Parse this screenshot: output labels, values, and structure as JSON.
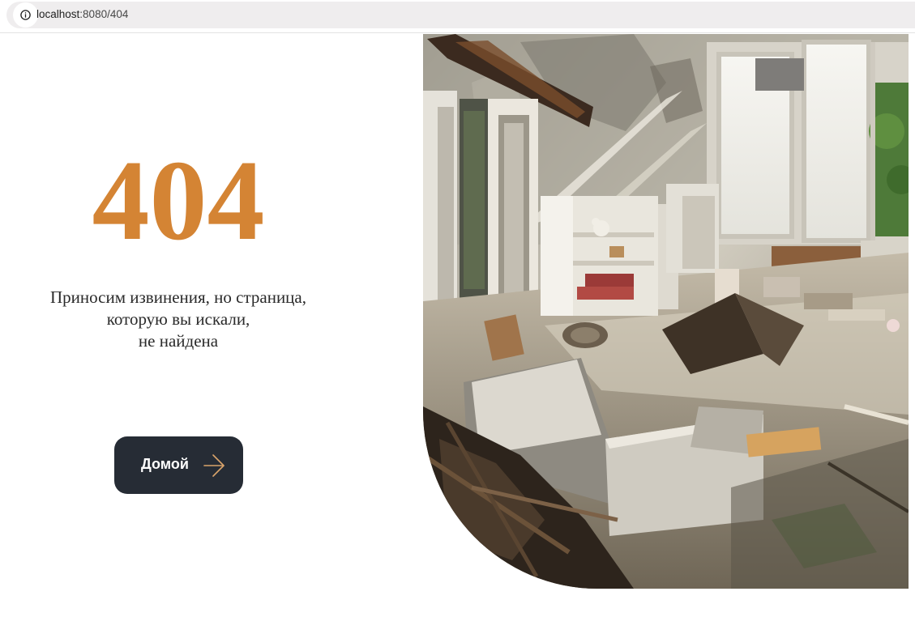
{
  "browser": {
    "url_host": "localhost",
    "url_path": ":8080/404",
    "info_icon": "info-icon"
  },
  "page": {
    "error_code": "404",
    "message_lines": [
      "Приносим извинения, но страница,",
      "которую вы искали,",
      "не найдена"
    ],
    "home_button": {
      "label": "Домой",
      "icon": "arrow-right-icon"
    },
    "accent_color": "#d48434",
    "button_color": "#262c35"
  }
}
